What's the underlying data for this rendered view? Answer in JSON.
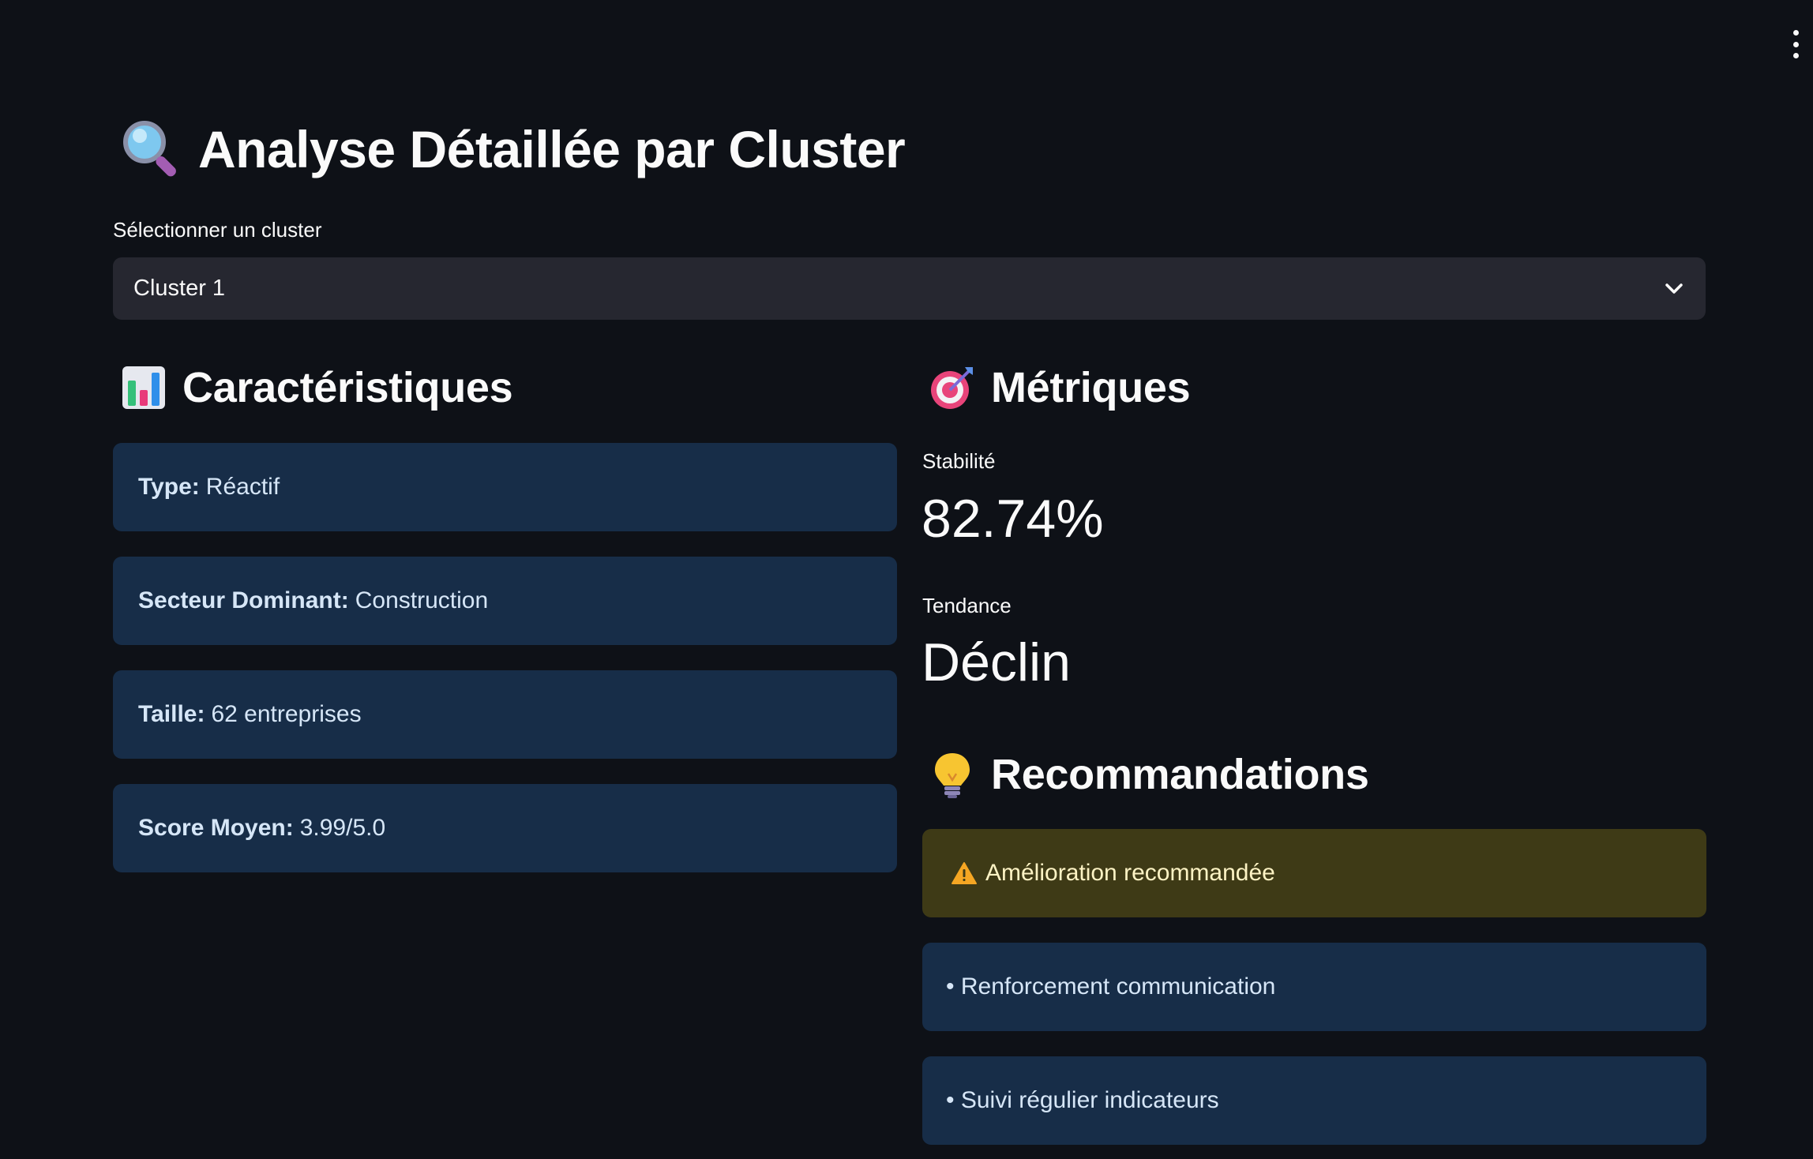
{
  "page": {
    "title": "Analyse Détaillée par Cluster",
    "title_icon": "magnifying-glass-icon"
  },
  "selector": {
    "label": "Sélectionner un cluster",
    "value": "Cluster 1",
    "icon": "chevron-down-icon"
  },
  "characteristics": {
    "heading": "Caractéristiques",
    "icon": "bar-chart-icon",
    "items": [
      {
        "key": "Type:",
        "value": "Réactif"
      },
      {
        "key": "Secteur Dominant:",
        "value": "Construction"
      },
      {
        "key": "Taille:",
        "value": "62 entreprises"
      },
      {
        "key": "Score Moyen:",
        "value": "3.99/5.0"
      }
    ]
  },
  "metrics": {
    "heading": "Métriques",
    "icon": "target-icon",
    "stability_label": "Stabilité",
    "stability_value": "82.74%",
    "trend_label": "Tendance",
    "trend_value": "Déclin"
  },
  "recommendations": {
    "heading": "Recommandations",
    "icon": "light-bulb-icon",
    "warning": "Amélioration recommandée",
    "warning_icon": "warning-icon",
    "items": [
      "• Renforcement communication",
      "• Suivi régulier indicateurs"
    ]
  },
  "colors": {
    "background": "#0e1117",
    "select_bg": "#262730",
    "info_bg": "#172d48",
    "warning_bg": "#3e3a16"
  }
}
